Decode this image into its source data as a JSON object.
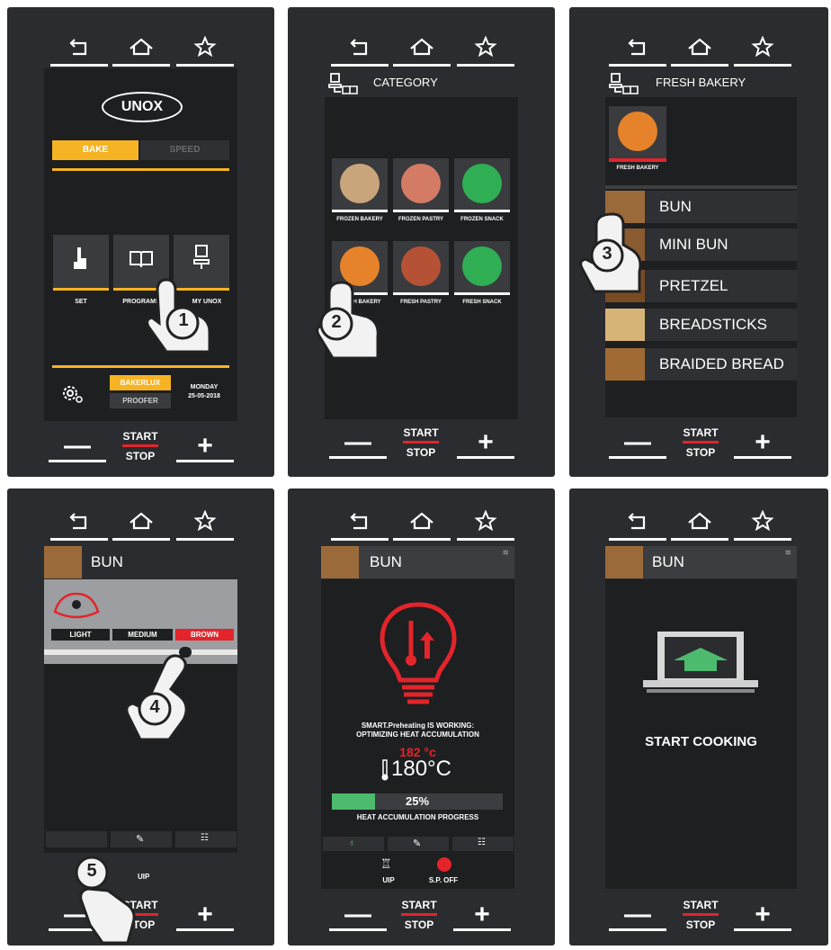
{
  "panel1": {
    "brand": "UNOX",
    "tab_bake": "BAKE",
    "tab_speed": "SPEED",
    "icons": [
      {
        "label": "SET"
      },
      {
        "label": "PROGRAMS"
      },
      {
        "label": "MY UNOX"
      }
    ],
    "bakerlux": "BAKERLUX",
    "proofer": "PROOFER",
    "day": "MONDAY",
    "date": "25-05-2018",
    "step": "1"
  },
  "panel2": {
    "header": "CATEGORY",
    "tiles": [
      {
        "label": "FROZEN BAKERY",
        "color": "#c9a57c"
      },
      {
        "label": "FROZEN PASTRY",
        "color": "#d47b66"
      },
      {
        "label": "FROZEN SNACK",
        "color": "#2fae54"
      },
      {
        "label": "FRESH BAKERY",
        "color": "#e6832a"
      },
      {
        "label": "FRESH PASTRY",
        "color": "#b55235"
      },
      {
        "label": "FRESH SNACK",
        "color": "#2fae54"
      }
    ],
    "step": "2"
  },
  "panel3": {
    "header": "FRESH BAKERY",
    "selected_label": "FRESH BAKERY",
    "items": [
      "BUN",
      "MINI BUN",
      "PRETZEL",
      "BREADSTICKS",
      "BRAIDED BREAD"
    ],
    "step": "3"
  },
  "panel4": {
    "title": "BUN",
    "options": [
      "LIGHT",
      "MEDIUM",
      "BROWN"
    ],
    "selected_option": "BROWN",
    "uip": "UIP",
    "step4": "4",
    "step5": "5"
  },
  "panel5": {
    "title": "BUN",
    "msg1": "SMART.Preheating IS WORKING:",
    "msg2": "OPTIMIZING HEAT ACCUMULATION",
    "set_temp": "182 °c",
    "temp": "180°C",
    "progress": 0.25,
    "progress_label": "25%",
    "progress_caption": "HEAT ACCUMULATION PROGRESS",
    "uip": "UIP",
    "sp_off": "S.P. OFF"
  },
  "panel6": {
    "title": "BUN",
    "message": "START COOKING"
  },
  "common": {
    "start": "START",
    "stop": "STOP",
    "minus": "—",
    "plus": "+"
  },
  "colors": {
    "accent_yellow": "#f6b323",
    "accent_red": "#e3242b",
    "progress_green": "#4dbb6e"
  }
}
